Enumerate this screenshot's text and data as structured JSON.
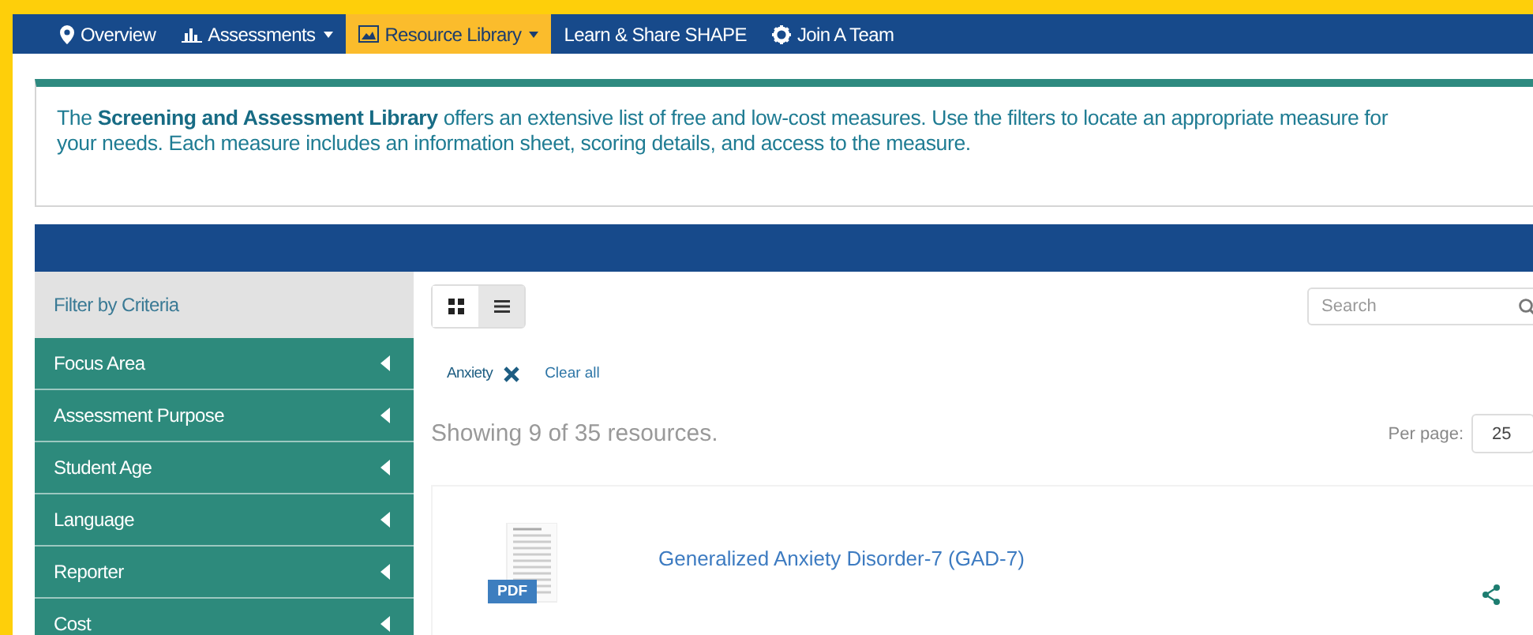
{
  "nav": [
    {
      "label": "Overview",
      "kind": "pin",
      "dropdown": false,
      "selected": false
    },
    {
      "label": "Assessments",
      "kind": "chart",
      "dropdown": true,
      "selected": false
    },
    {
      "label": "Resource Library",
      "kind": "picture",
      "dropdown": true,
      "selected": true
    },
    {
      "label": "Learn & Share SHAPE",
      "kind": "text",
      "dropdown": false,
      "selected": false
    },
    {
      "label": "Join A Team",
      "kind": "gear",
      "dropdown": false,
      "selected": false
    }
  ],
  "intro": "The **Screening and Assessment Library** offers an extensive list of free and low-cost measures. Use the filters to locate an appropriate measure for your needs. Each measure includes an information sheet, scoring details, and access to the measure.",
  "sidebar": {
    "title": "Filter by Criteria",
    "items": [
      {
        "label": "Focus Area",
        "expanded": false
      },
      {
        "label": "Assessment Purpose",
        "expanded": false
      },
      {
        "label": "Student Age",
        "expanded": false
      },
      {
        "label": "Language",
        "expanded": false
      },
      {
        "label": "Reporter",
        "expanded": false
      },
      {
        "label": "Cost",
        "expanded": false
      }
    ]
  },
  "view_toggle": [
    {
      "kind": "grid",
      "selected": false
    },
    {
      "kind": "list",
      "selected": true
    }
  ],
  "search": {
    "placeholder": "Search"
  },
  "active_filters": [
    {
      "label": "Anxiety"
    }
  ],
  "clear_all": "Clear all",
  "result_count": "Showing 9 of 35 resources.",
  "per_page": {
    "label": "Per page:",
    "value": "25"
  },
  "resources": [
    {
      "title": "Generalized Anxiety Disorder-7 (GAD-7)",
      "file_badge": "PDF"
    }
  ]
}
